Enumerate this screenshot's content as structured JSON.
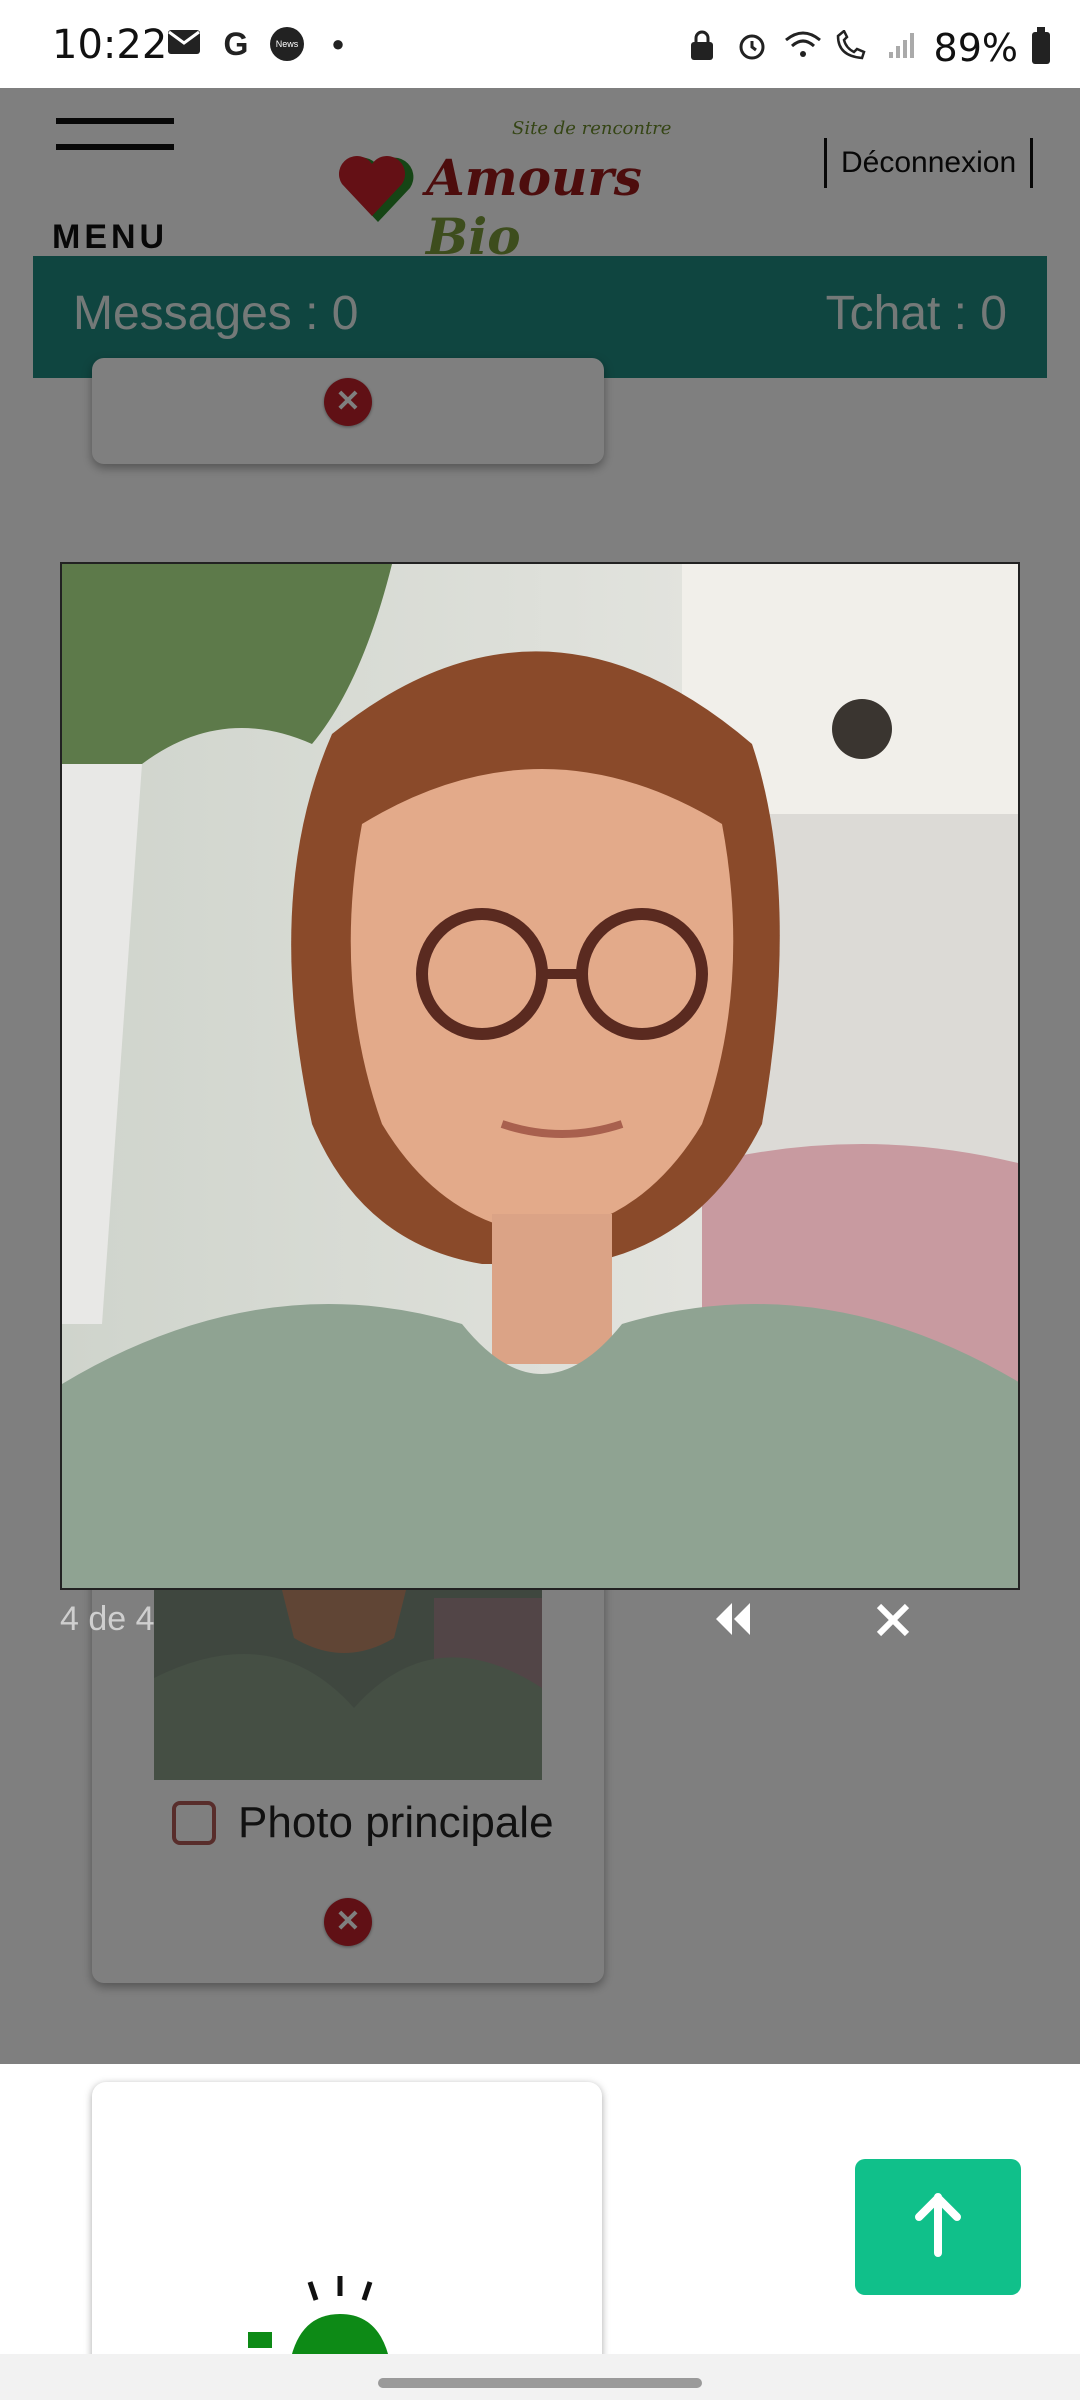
{
  "status_bar": {
    "time": "10:22",
    "left_icons": [
      "mail-icon",
      "google-icon",
      "news-icon",
      "dot-icon"
    ],
    "news_label": "News",
    "right_icons": [
      "vpn-lock-icon",
      "alarm-icon",
      "wifi-icon",
      "wifi-call-icon",
      "signal-icon"
    ],
    "battery": "89%"
  },
  "header": {
    "menu_label": "MENU",
    "logo_tagline": "Site de rencontre",
    "logo_name_1": "Amours",
    "logo_name_2": "Bio",
    "logout_label": "Déconnexion"
  },
  "counters": {
    "messages": "Messages : 0",
    "tchat": "Tchat : 0"
  },
  "photo_card": {
    "checkbox_label": "Photo principale"
  },
  "lightbox": {
    "counter": "4 de 4",
    "prev_icon": "rewind-icon",
    "close_icon": "close-icon"
  },
  "colors": {
    "teal_bar": "#1f8a80",
    "delete_red": "#c0202a",
    "scroll_button": "#10c08a",
    "checkbox_border": "#b05a56"
  }
}
